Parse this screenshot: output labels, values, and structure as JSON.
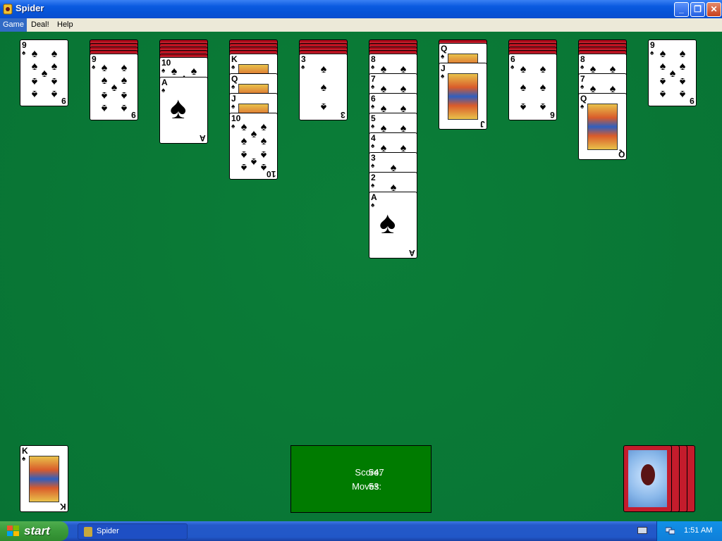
{
  "window": {
    "title": "Spider",
    "controls": [
      "minimize",
      "maximize",
      "close"
    ]
  },
  "menu": {
    "items": [
      {
        "label": "Game",
        "active": true
      },
      {
        "label": "Deal!",
        "active": false
      },
      {
        "label": "Help",
        "active": false
      }
    ]
  },
  "tableau": {
    "columns": [
      {
        "face_down": 0,
        "cards": [
          "9"
        ]
      },
      {
        "face_down": 4,
        "cards": [
          "9"
        ]
      },
      {
        "face_down": 5,
        "cards": [
          "10",
          "A"
        ]
      },
      {
        "face_down": 4,
        "cards": [
          "K",
          "Q",
          "J",
          "10"
        ]
      },
      {
        "face_down": 4,
        "cards": [
          "3"
        ]
      },
      {
        "face_down": 4,
        "cards": [
          "8",
          "7",
          "6",
          "5",
          "4",
          "3",
          "2",
          "A"
        ]
      },
      {
        "face_down": 1,
        "cards": [
          "Q",
          "J"
        ]
      },
      {
        "face_down": 4,
        "cards": [
          "6"
        ]
      },
      {
        "face_down": 4,
        "cards": [
          "8",
          "7",
          "Q"
        ]
      },
      {
        "face_down": 0,
        "cards": [
          "9"
        ]
      }
    ],
    "suit": "♠"
  },
  "foundation": {
    "completed": [
      {
        "top_card": "K",
        "suit": "♠"
      }
    ]
  },
  "score": {
    "score_label": "Score:",
    "score_value": "547",
    "moves_label": "Moves:",
    "moves_value": "53"
  },
  "stock": {
    "remaining_deals": 4
  },
  "taskbar": {
    "start_label": "start",
    "task_label": "Spider",
    "clock": "1:51 AM"
  },
  "colors": {
    "felt": "#0b7a35",
    "card_back": "#c41c2c",
    "score_box": "#007b00",
    "title_bar": "#0a5ae0"
  }
}
